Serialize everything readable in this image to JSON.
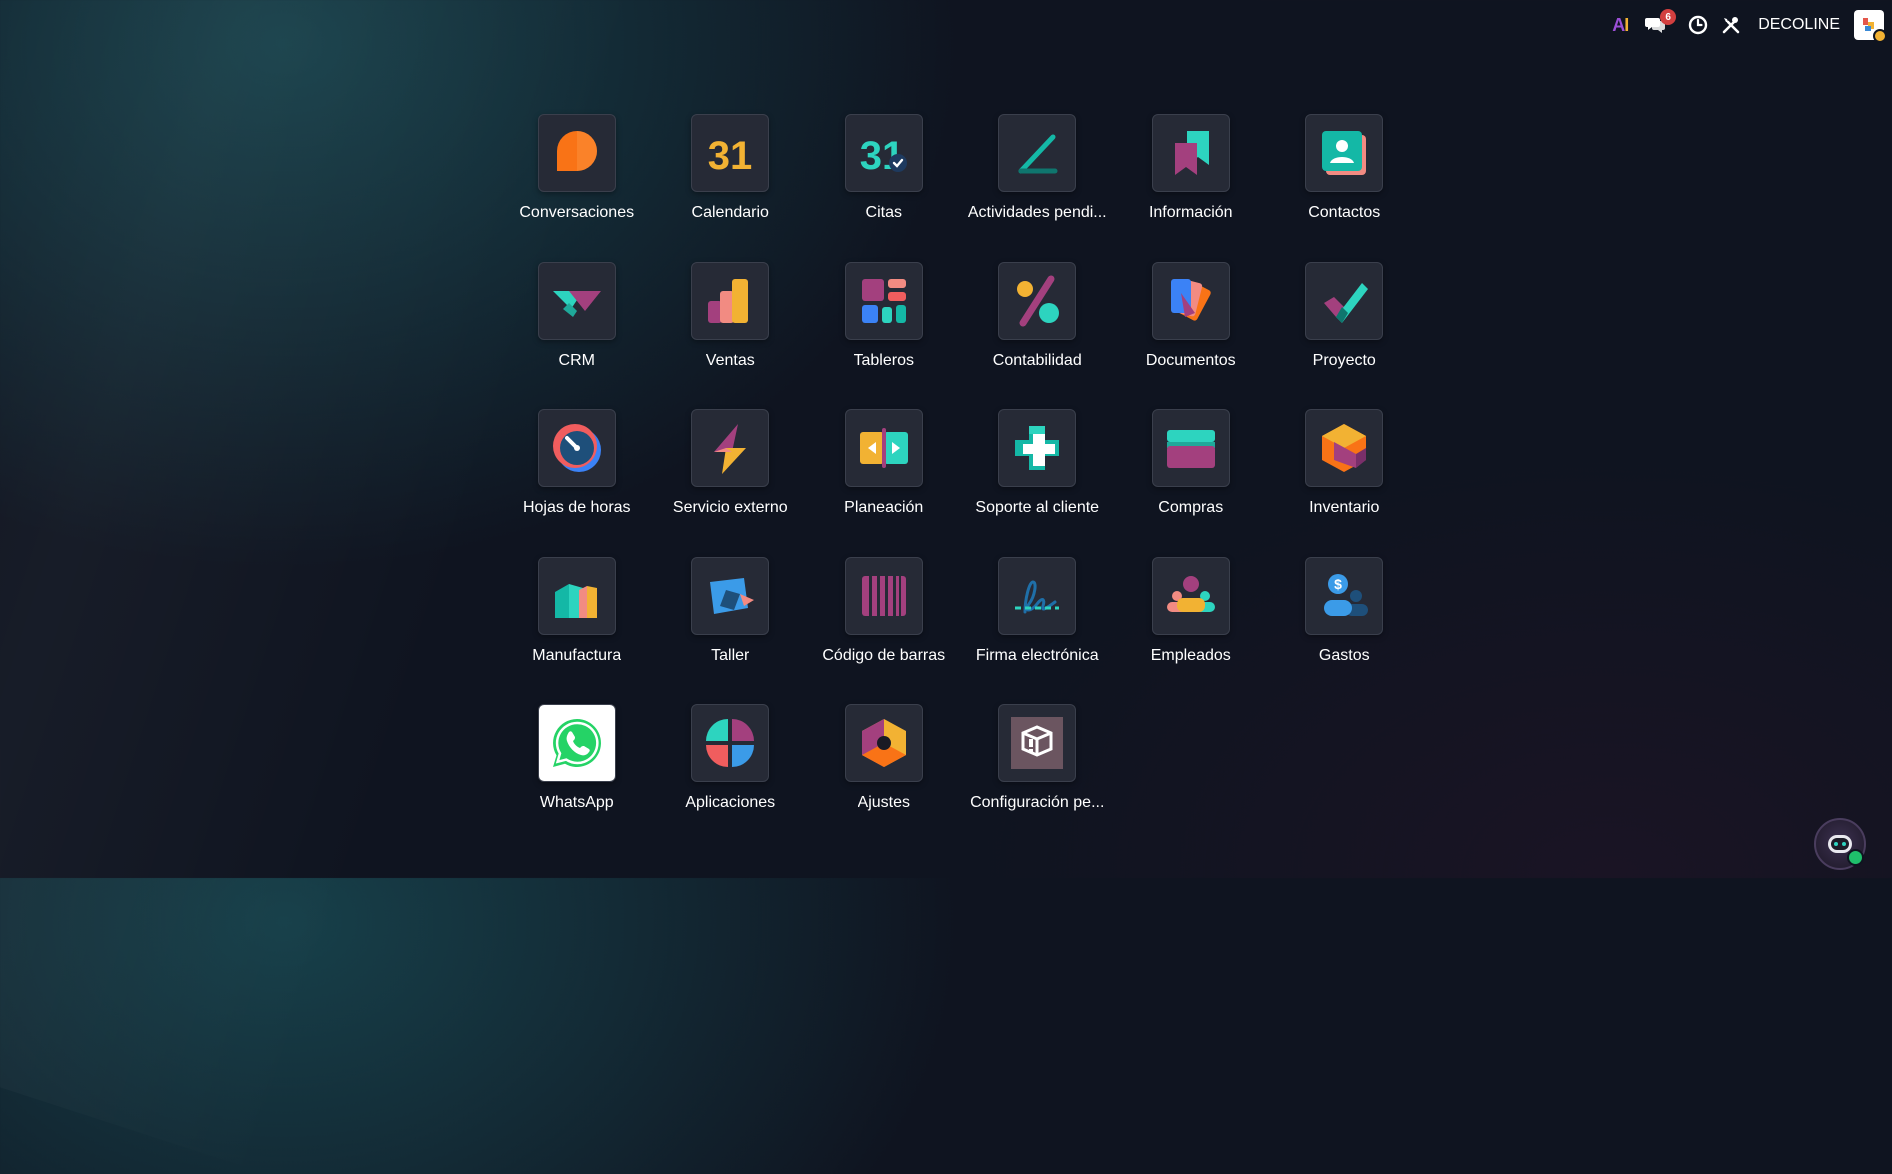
{
  "topbar": {
    "ai_label_a": "A",
    "ai_label_i": "I",
    "messages_count": "6",
    "company_name": "DECOLINE"
  },
  "colors": {
    "accent_purple": "#9b4fd6",
    "accent_yellow": "#f2b233",
    "badge_red": "#d23f3f"
  },
  "apps": [
    {
      "label": "Conversaciones",
      "icon": "discuss-icon"
    },
    {
      "label": "Calendario",
      "icon": "calendar-icon"
    },
    {
      "label": "Citas",
      "icon": "appointments-icon"
    },
    {
      "label": "Actividades pendi...",
      "icon": "activities-icon"
    },
    {
      "label": "Información",
      "icon": "knowledge-icon"
    },
    {
      "label": "Contactos",
      "icon": "contacts-icon"
    },
    {
      "label": "CRM",
      "icon": "crm-icon"
    },
    {
      "label": "Ventas",
      "icon": "sales-icon"
    },
    {
      "label": "Tableros",
      "icon": "dashboards-icon"
    },
    {
      "label": "Contabilidad",
      "icon": "accounting-icon"
    },
    {
      "label": "Documentos",
      "icon": "documents-icon"
    },
    {
      "label": "Proyecto",
      "icon": "project-icon"
    },
    {
      "label": "Hojas de horas",
      "icon": "timesheets-icon"
    },
    {
      "label": "Servicio externo",
      "icon": "field-service-icon"
    },
    {
      "label": "Planeación",
      "icon": "planning-icon"
    },
    {
      "label": "Soporte al cliente",
      "icon": "helpdesk-icon"
    },
    {
      "label": "Compras",
      "icon": "purchase-icon"
    },
    {
      "label": "Inventario",
      "icon": "inventory-icon"
    },
    {
      "label": "Manufactura",
      "icon": "manufacturing-icon"
    },
    {
      "label": "Taller",
      "icon": "repairs-icon"
    },
    {
      "label": "Código de barras",
      "icon": "barcode-icon"
    },
    {
      "label": "Firma electrónica",
      "icon": "sign-icon"
    },
    {
      "label": "Empleados",
      "icon": "employees-icon"
    },
    {
      "label": "Gastos",
      "icon": "expenses-icon"
    },
    {
      "label": "WhatsApp",
      "icon": "whatsapp-icon"
    },
    {
      "label": "Aplicaciones",
      "icon": "apps-icon"
    },
    {
      "label": "Ajustes",
      "icon": "settings-icon"
    },
    {
      "label": "Configuración pe...",
      "icon": "custom-config-icon"
    }
  ],
  "calendar_day": "31",
  "appointments_day": "31"
}
